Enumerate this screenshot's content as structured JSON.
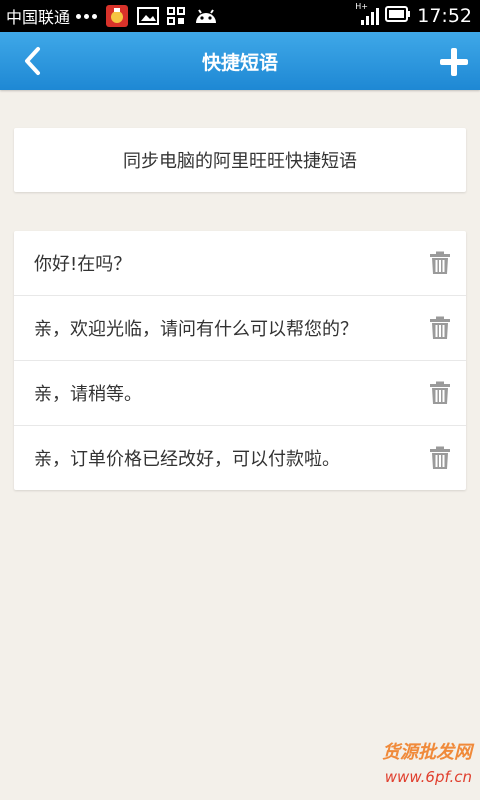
{
  "statusbar": {
    "carrier": "中国联通",
    "network": "H+",
    "time": "17:52"
  },
  "header": {
    "title": "快捷短语"
  },
  "sync": {
    "label": "同步电脑的阿里旺旺快捷短语"
  },
  "phrases": [
    {
      "text": "你好!在吗？"
    },
    {
      "text": "亲，欢迎光临，请问有什么可以帮您的？"
    },
    {
      "text": "亲，请稍等。"
    },
    {
      "text": "亲，订单价格已经改好，可以付款啦。"
    }
  ],
  "watermark": {
    "line1": "货源批发网",
    "line2": "www.6pf.cn"
  },
  "colors": {
    "accent": "#2d98de",
    "background": "#f3f0ea"
  }
}
